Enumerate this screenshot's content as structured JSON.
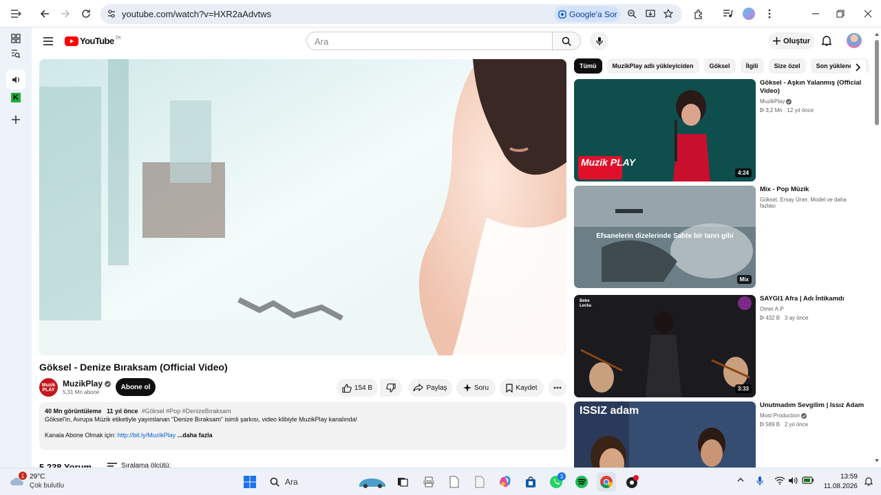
{
  "browser": {
    "url": "youtube.com/watch?v=HXR2aAdvtws",
    "google_ask": "Google'a Sor",
    "avatar_letter": "",
    "accent": "#0b57d0"
  },
  "youtube": {
    "logo_text": "YouTube",
    "region": "TR",
    "search_placeholder": "Ara",
    "create_label": "Oluştur",
    "colors": {
      "brand_red": "#ff0000",
      "subscribe_bg": "#0f0f0f"
    }
  },
  "video": {
    "title": "Göksel - Denize Bıraksam (Official Video)",
    "channel": "MuzikPlay",
    "channel_logo": "Muzik PLAY",
    "subscribers": "5,31 Mn abone",
    "subscribe_label": "Abone ol",
    "likes": "154 B",
    "share_label": "Paylaş",
    "ask_label": "Soru",
    "save_label": "Kaydet"
  },
  "description": {
    "views": "40 Mn görüntüleme",
    "age": "11 yıl önce",
    "tags": "#Göksel #Pop #DenizeBıraksam",
    "line1": "Göksel'in, Avrupa Müzik etiketiyle yayımlanan \"Denize Bıraksam\" isimli şarkısı, video klibiyle MuzikPlay kanalında!",
    "line2_prefix": "Kanala Abone Olmak için:",
    "line2_link": "http://bit.ly/MuzikPlay",
    "more": "...daha fazla"
  },
  "comments": {
    "count": "5.238 Yorum",
    "sort_label": "Sıralama ölçütü:"
  },
  "chips": [
    "Tümü",
    "MuzikPlay adlı yükleyiciden",
    "Göksel",
    "İlgili",
    "Size özel",
    "Son yüklenenler"
  ],
  "recommendations": [
    {
      "title": "Göksel - Aşkın Yalanmış (Official Video)",
      "channel": "MuzikPlay",
      "verified": true,
      "views": "3,2 Mn",
      "age": "12 yıl önce",
      "duration": "4:24",
      "overlay": "Muzik PLAY"
    },
    {
      "title": "Mix - Pop Müzik",
      "channel": "Göksel, Ersay Üner, Model ve daha fazlası",
      "verified": false,
      "views": "",
      "age": "",
      "duration": "Mix",
      "overlay": "Efsanelerin dizelerinde Sahte bir tanrı gibi"
    },
    {
      "title": "SAYGI1 Afra | Adı İntikamdı",
      "channel": "Omer A.P",
      "verified": false,
      "views": "432 B",
      "age": "3 ay önce",
      "duration": "3:33",
      "overlay": "Bebe Lecka"
    },
    {
      "title": "Unutmadım Sevgilim | Issız Adam",
      "channel": "Most Production",
      "verified": true,
      "views": "589 B",
      "age": "2 yıl önce",
      "duration": "",
      "overlay": "ISSIZ adam"
    }
  ],
  "taskbar": {
    "temp": "29°C",
    "weather": "Çok bulutlu",
    "weather_badge": "1",
    "search": "Ara",
    "whatsapp_badge": "3",
    "time": "13:59",
    "date": "11.08.2026"
  }
}
